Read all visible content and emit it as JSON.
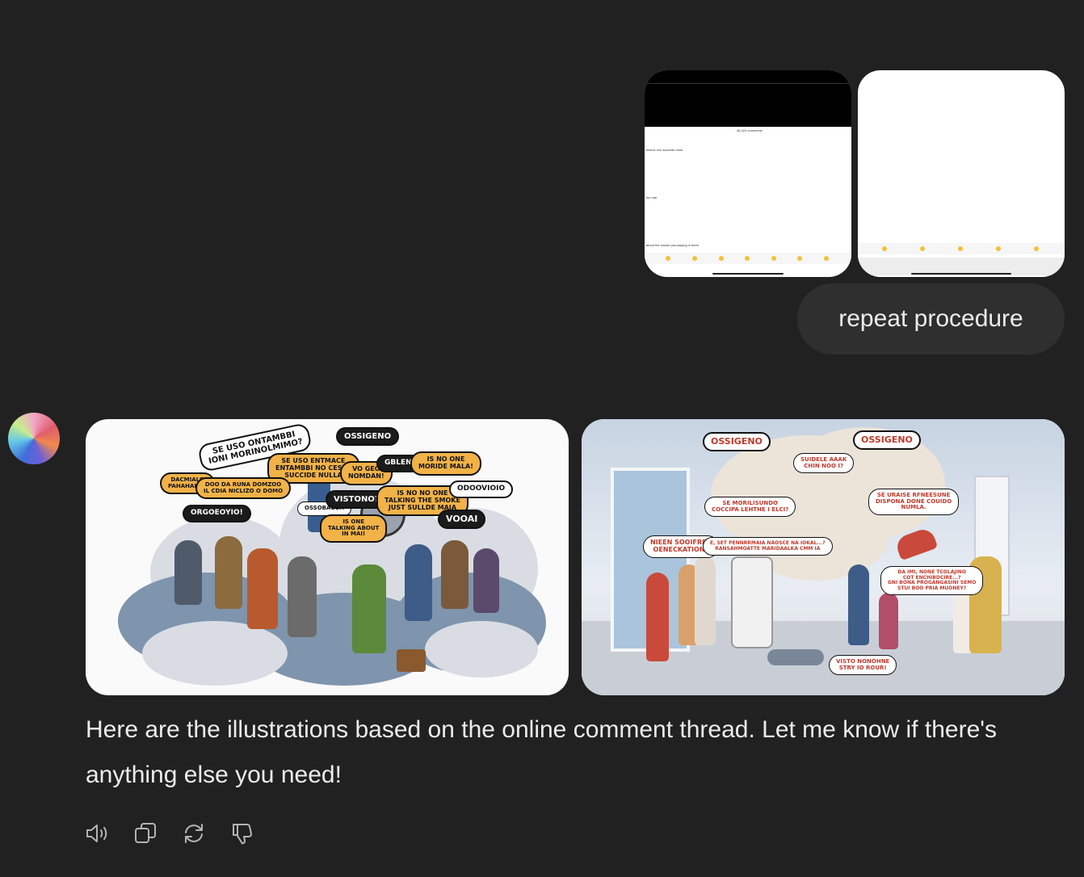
{
  "user_message": {
    "attachments": [
      {
        "type": "screenshot",
        "texts": [
          "36,424 comments",
          "invece non succede nulla",
          "ino mai",
          "about the smoke just staying in there"
        ]
      },
      {
        "type": "screenshot",
        "texts": []
      }
    ],
    "text": "repeat procedure"
  },
  "assistant_message": {
    "images": [
      {
        "speech_bubbles": [
          "SE USO ONTAMBBI\nIONI MORINOLMIMO?",
          "OSSIGENO",
          "SE USO ENTMACE\nENTAMBBI NO CESCE\nSUCCIDE NULLA",
          "VO GEO\nNOMDAN!",
          "GBLENO",
          "IS NO ONE\nMORIDE MALA!",
          "DACMIALO\nPAHAHALIA!",
          "DOO DA RUNA DOMZOO\nIL CDIA NICLIZO O DOMO",
          "OSSOBACOA",
          "VISTONO?",
          "IS NO NO ONE\nTALKING THE SMOKE\nJUST SULLDE MAIA",
          "ODOOVIOIO",
          "ORGOEOYIO!",
          "IS ONE\nTALKING ABOUT\nIN MAI!",
          "VOOAI"
        ]
      },
      {
        "speech_bubbles": [
          "OSSIGENO",
          "OSSIGENO",
          "SUIDELE AAAK\nCHIN NOO I?",
          "SE URAISE RFNEESUNE\nDISPONA DONE COUIDO\nNUMLA.",
          "SE MORILISUNDO\nCOCCIPA LEHTHE I ELCI?",
          "NIEEN SOOIFREA\nOENECKATION?",
          "E, SET PENNRRMAIA NAOSCE NA IOKAL...?\nRANSAHMOATTE MARIDAALKA CMM IA",
          "DA IMI, NONE TCOLAJINO\nCOT ENCHIBDCIRE...?\nGNI BONA PROGANGASINI SEMO\nSTUI BOO PRIA MUONEY?",
          "VISTO NONOHNE\nSTRY IO ROUR!"
        ]
      }
    ],
    "text": "Here are the illustrations based on the online comment thread. Let me know if there's anything else you need!",
    "actions": [
      {
        "icon": "read-aloud-icon"
      },
      {
        "icon": "copy-icon"
      },
      {
        "icon": "regenerate-icon"
      },
      {
        "icon": "thumbs-down-icon"
      }
    ]
  }
}
